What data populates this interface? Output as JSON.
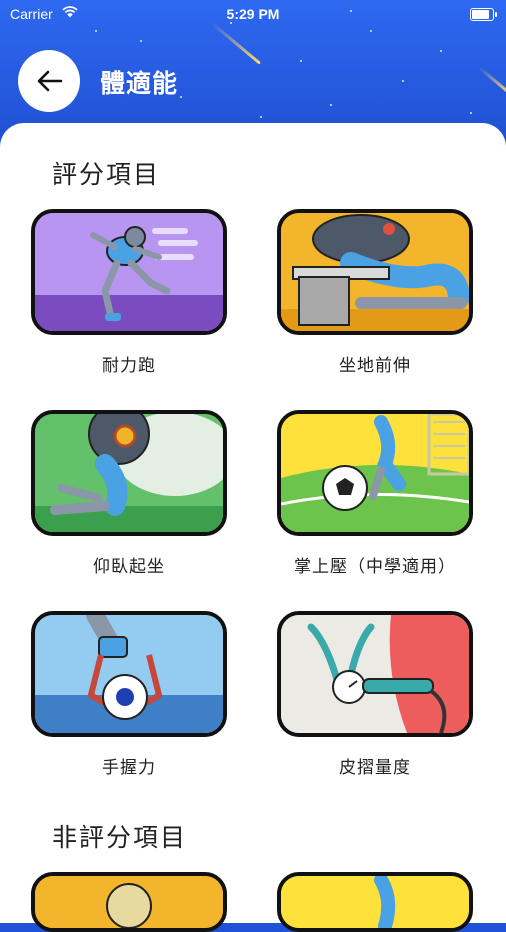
{
  "status_bar": {
    "carrier": "Carrier",
    "time": "5:29 PM",
    "battery_level": 0.95
  },
  "header": {
    "title": "體適能",
    "back_icon": "arrow-left-icon",
    "background": "#1f52d9"
  },
  "sections": [
    {
      "title": "評分項目",
      "items": [
        {
          "label": "耐力跑",
          "icon": "running-illustration"
        },
        {
          "label": "坐地前伸",
          "icon": "sit-and-reach-illustration"
        },
        {
          "label": "仰臥起坐",
          "icon": "sit-up-illustration"
        },
        {
          "label": "掌上壓（中學適用）",
          "icon": "push-up-illustration"
        },
        {
          "label": "手握力",
          "icon": "hand-grip-illustration"
        },
        {
          "label": "皮摺量度",
          "icon": "skinfold-caliper-illustration"
        }
      ]
    },
    {
      "title": "非評分項目",
      "items": [
        {
          "label": "",
          "icon": "partial-card-illustration"
        },
        {
          "label": "",
          "icon": "partial-card-illustration"
        }
      ]
    }
  ]
}
